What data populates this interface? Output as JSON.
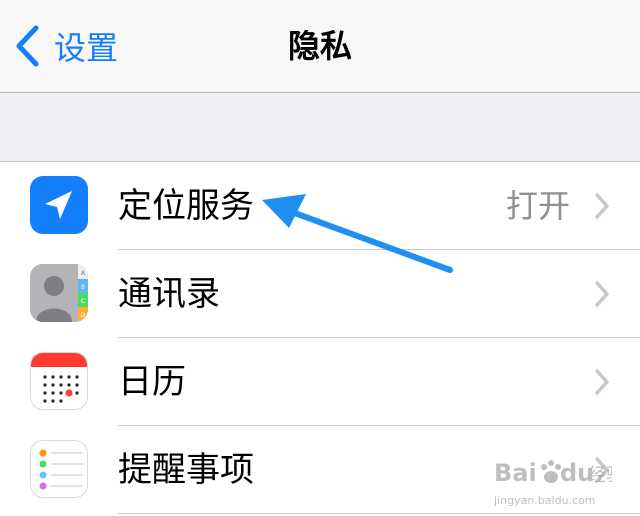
{
  "navbar": {
    "back_label": "设置",
    "title": "隐私"
  },
  "rows": [
    {
      "label": "定位服务",
      "value": "打开",
      "icon": "location-arrow-icon"
    },
    {
      "label": "通讯录",
      "value": "",
      "icon": "contacts-icon"
    },
    {
      "label": "日历",
      "value": "",
      "icon": "calendar-icon"
    },
    {
      "label": "提醒事项",
      "value": "",
      "icon": "reminders-icon"
    }
  ],
  "contacts_index_letters": [
    "A",
    "B",
    "C",
    "D"
  ],
  "watermark": {
    "brand": "Bai",
    "brand2": "du",
    "name": "经验",
    "url": "jingyan.baidu.com"
  },
  "colors": {
    "accent": "#147efb",
    "annotation_arrow": "#1f8ff0",
    "chevron": "#c7c7cc",
    "value_text": "#8e8e93"
  }
}
